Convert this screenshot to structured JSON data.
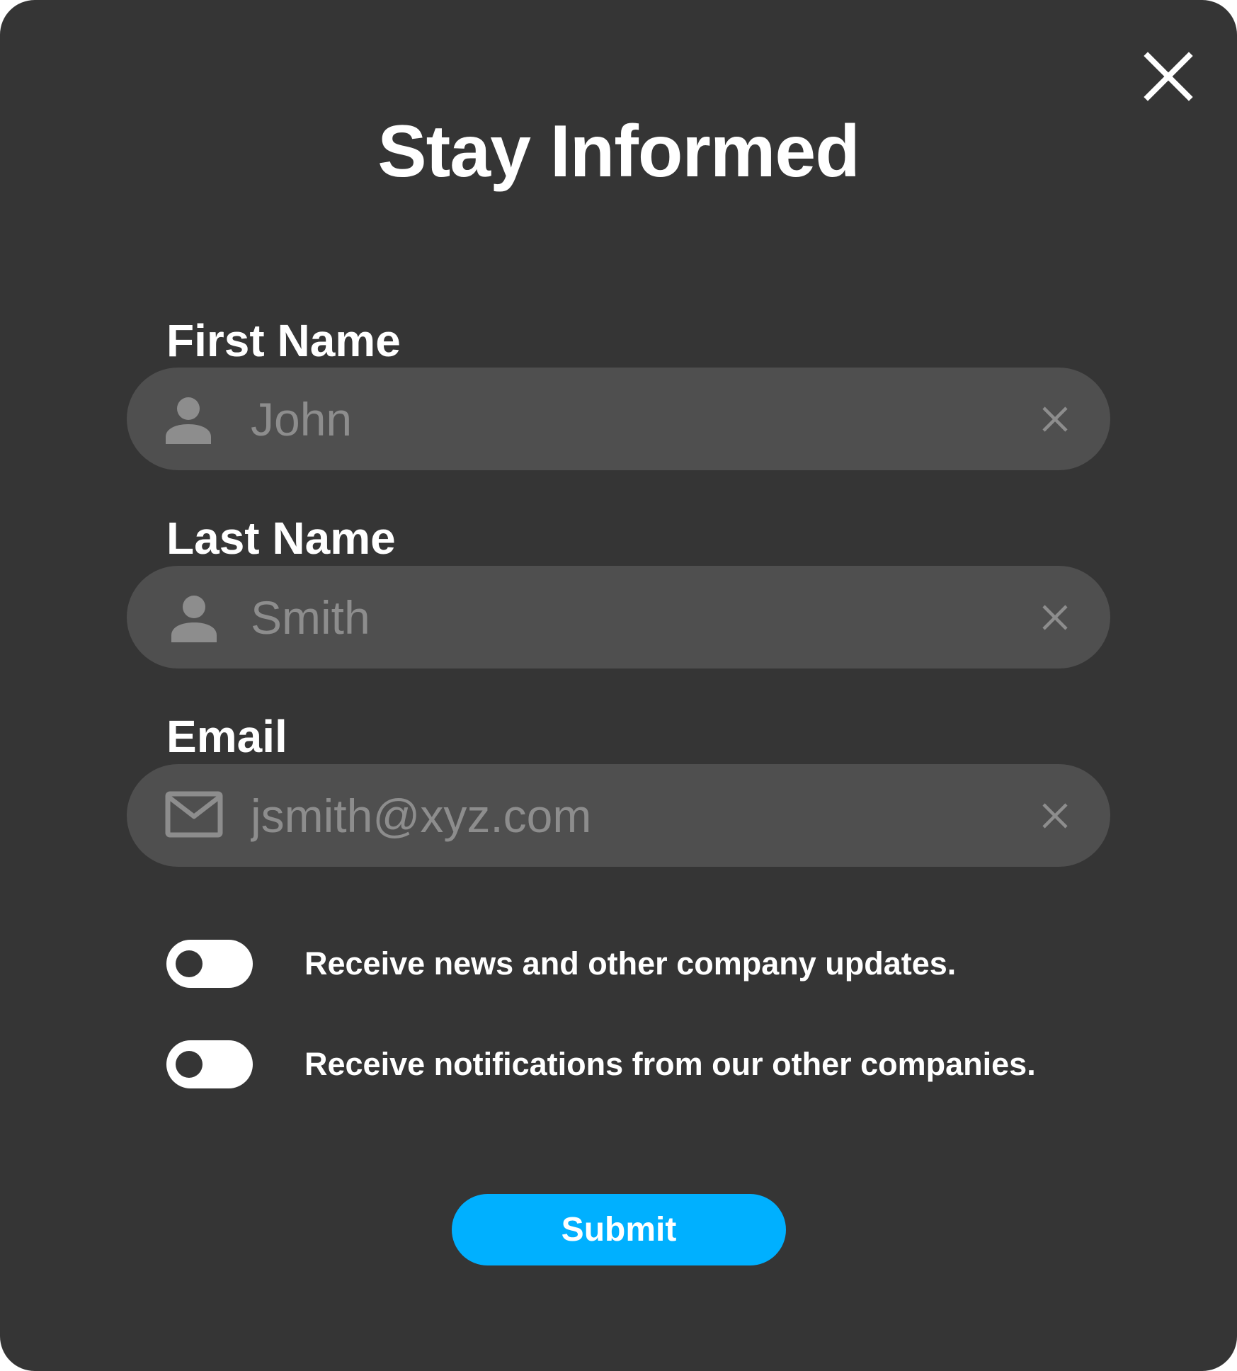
{
  "dialog": {
    "title": "Stay Informed",
    "close_icon": "close-icon"
  },
  "form": {
    "first_name": {
      "label": "First Name",
      "placeholder": "John",
      "icon": "person-icon"
    },
    "last_name": {
      "label": "Last Name",
      "placeholder": "Smith",
      "icon": "person-icon"
    },
    "email": {
      "label": "Email",
      "placeholder": "jsmith@xyz.com",
      "icon": "mail-icon"
    },
    "toggles": [
      {
        "label": "Receive news and other company updates.",
        "on": false
      },
      {
        "label": "Receive notifications from our other companies.",
        "on": false
      }
    ],
    "submit_label": "Submit"
  },
  "colors": {
    "background": "#353535",
    "field": "#4f4f4f",
    "placeholder": "#8d8d8d",
    "accent": "#00b0ff",
    "text": "#ffffff"
  }
}
